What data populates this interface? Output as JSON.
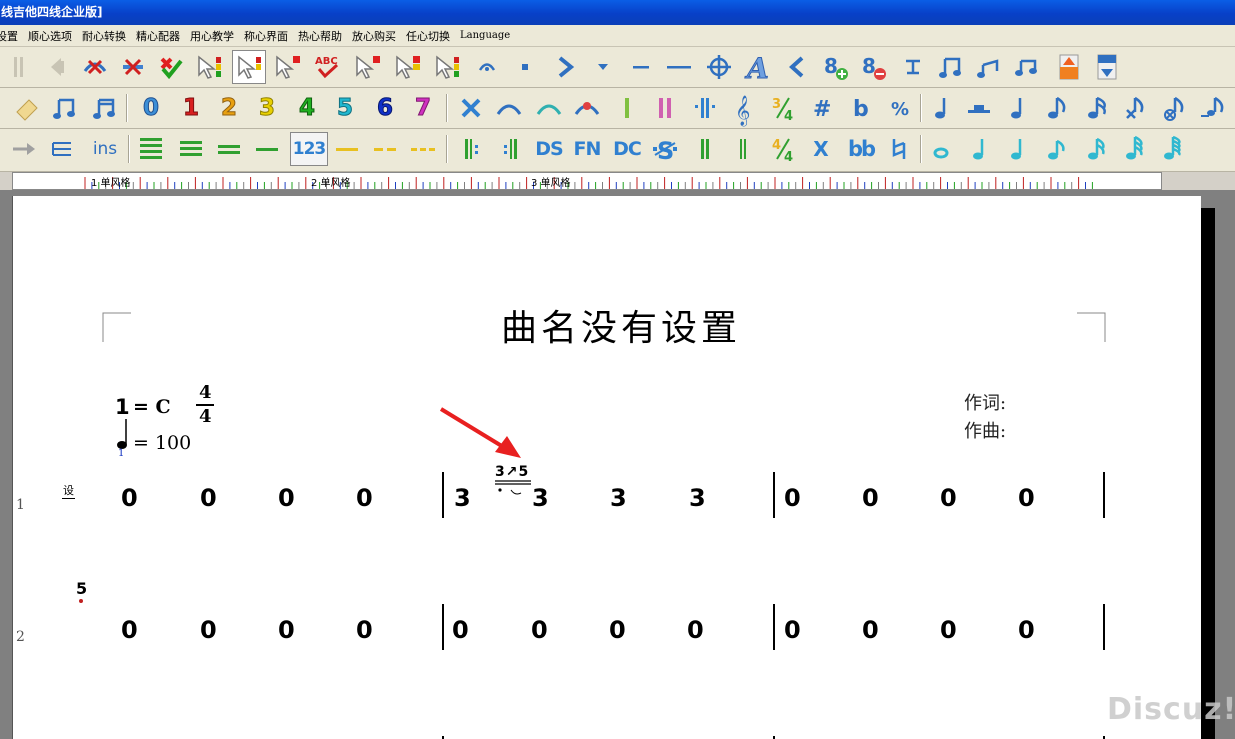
{
  "window": {
    "title": "线吉他四线企业版]"
  },
  "menu": [
    "设置",
    "顺心选项",
    "耐心转换",
    "精心配器",
    "用心教学",
    "称心界面",
    "热心帮助",
    "放心购买",
    "任心切换",
    "Language"
  ],
  "toolbar1": {
    "items": [
      "||",
      "◀",
      "✕",
      "✕",
      "✓",
      "☞",
      "☞",
      "☞",
      "✓",
      "ABC",
      "☞",
      "☞",
      "☞",
      "◠",
      "▪",
      "❯",
      "▾",
      "—",
      "—",
      "⊕",
      "A",
      "❮",
      "8",
      "8",
      "工",
      "♫",
      "♩",
      "♫",
      "▲",
      "▼"
    ]
  },
  "toolbar2": {
    "digits": [
      "0",
      "1",
      "2",
      "3",
      "4",
      "5",
      "6",
      "7"
    ],
    "symbols": [
      "✕",
      "⌒",
      "⌒",
      "⌒",
      "|",
      "||",
      "|:|",
      "𝄞",
      "3/4",
      "#",
      "b",
      "%",
      "♩",
      "–",
      "♩",
      "♪",
      "♪",
      "♪",
      "♪",
      "♪"
    ],
    "digit_colors": [
      "#3c8fd6",
      "#d82020",
      "#e8a010",
      "#e8d000",
      "#20b020",
      "#20b8d0",
      "#1030c8",
      "#d030c0"
    ]
  },
  "toolbar3": {
    "ins_label": "ins",
    "num_label": "123",
    "ds_label": "DS",
    "fn_label": "FN",
    "dc_label": "DC",
    "x_label": "X",
    "bb_label": "bb",
    "time_sig": "4/4"
  },
  "ruler": {
    "labels": [
      "1  单风格",
      "2  单风格",
      "3  单风格"
    ]
  },
  "score": {
    "title": "曲名没有设置",
    "key_num": "1",
    "key_eq": "= C",
    "time_top": "4",
    "time_bottom": "4",
    "tempo_eq": "= 100",
    "lyricist": "作词:",
    "composer": "作曲:",
    "setting_mark": "设",
    "row1_label": "1",
    "row2_label": "2",
    "row1": {
      "bar1": [
        "0",
        "0",
        "0",
        "0"
      ],
      "bar2": [
        "3",
        "3",
        "3",
        "3"
      ],
      "bar3": [
        "0",
        "0",
        "0",
        "0"
      ]
    },
    "row2": {
      "bar1": [
        "0",
        "0",
        "0",
        "0"
      ],
      "bar2": [
        "0",
        "0",
        "0",
        "0"
      ],
      "bar3": [
        "0",
        "0",
        "0",
        "0"
      ]
    },
    "grace_annotation": "3↗5",
    "small_note": "5"
  },
  "colors": {
    "annotation_arrow": "#e82020",
    "titlebar": "#0a4fd6"
  },
  "watermark": "Discuz!"
}
